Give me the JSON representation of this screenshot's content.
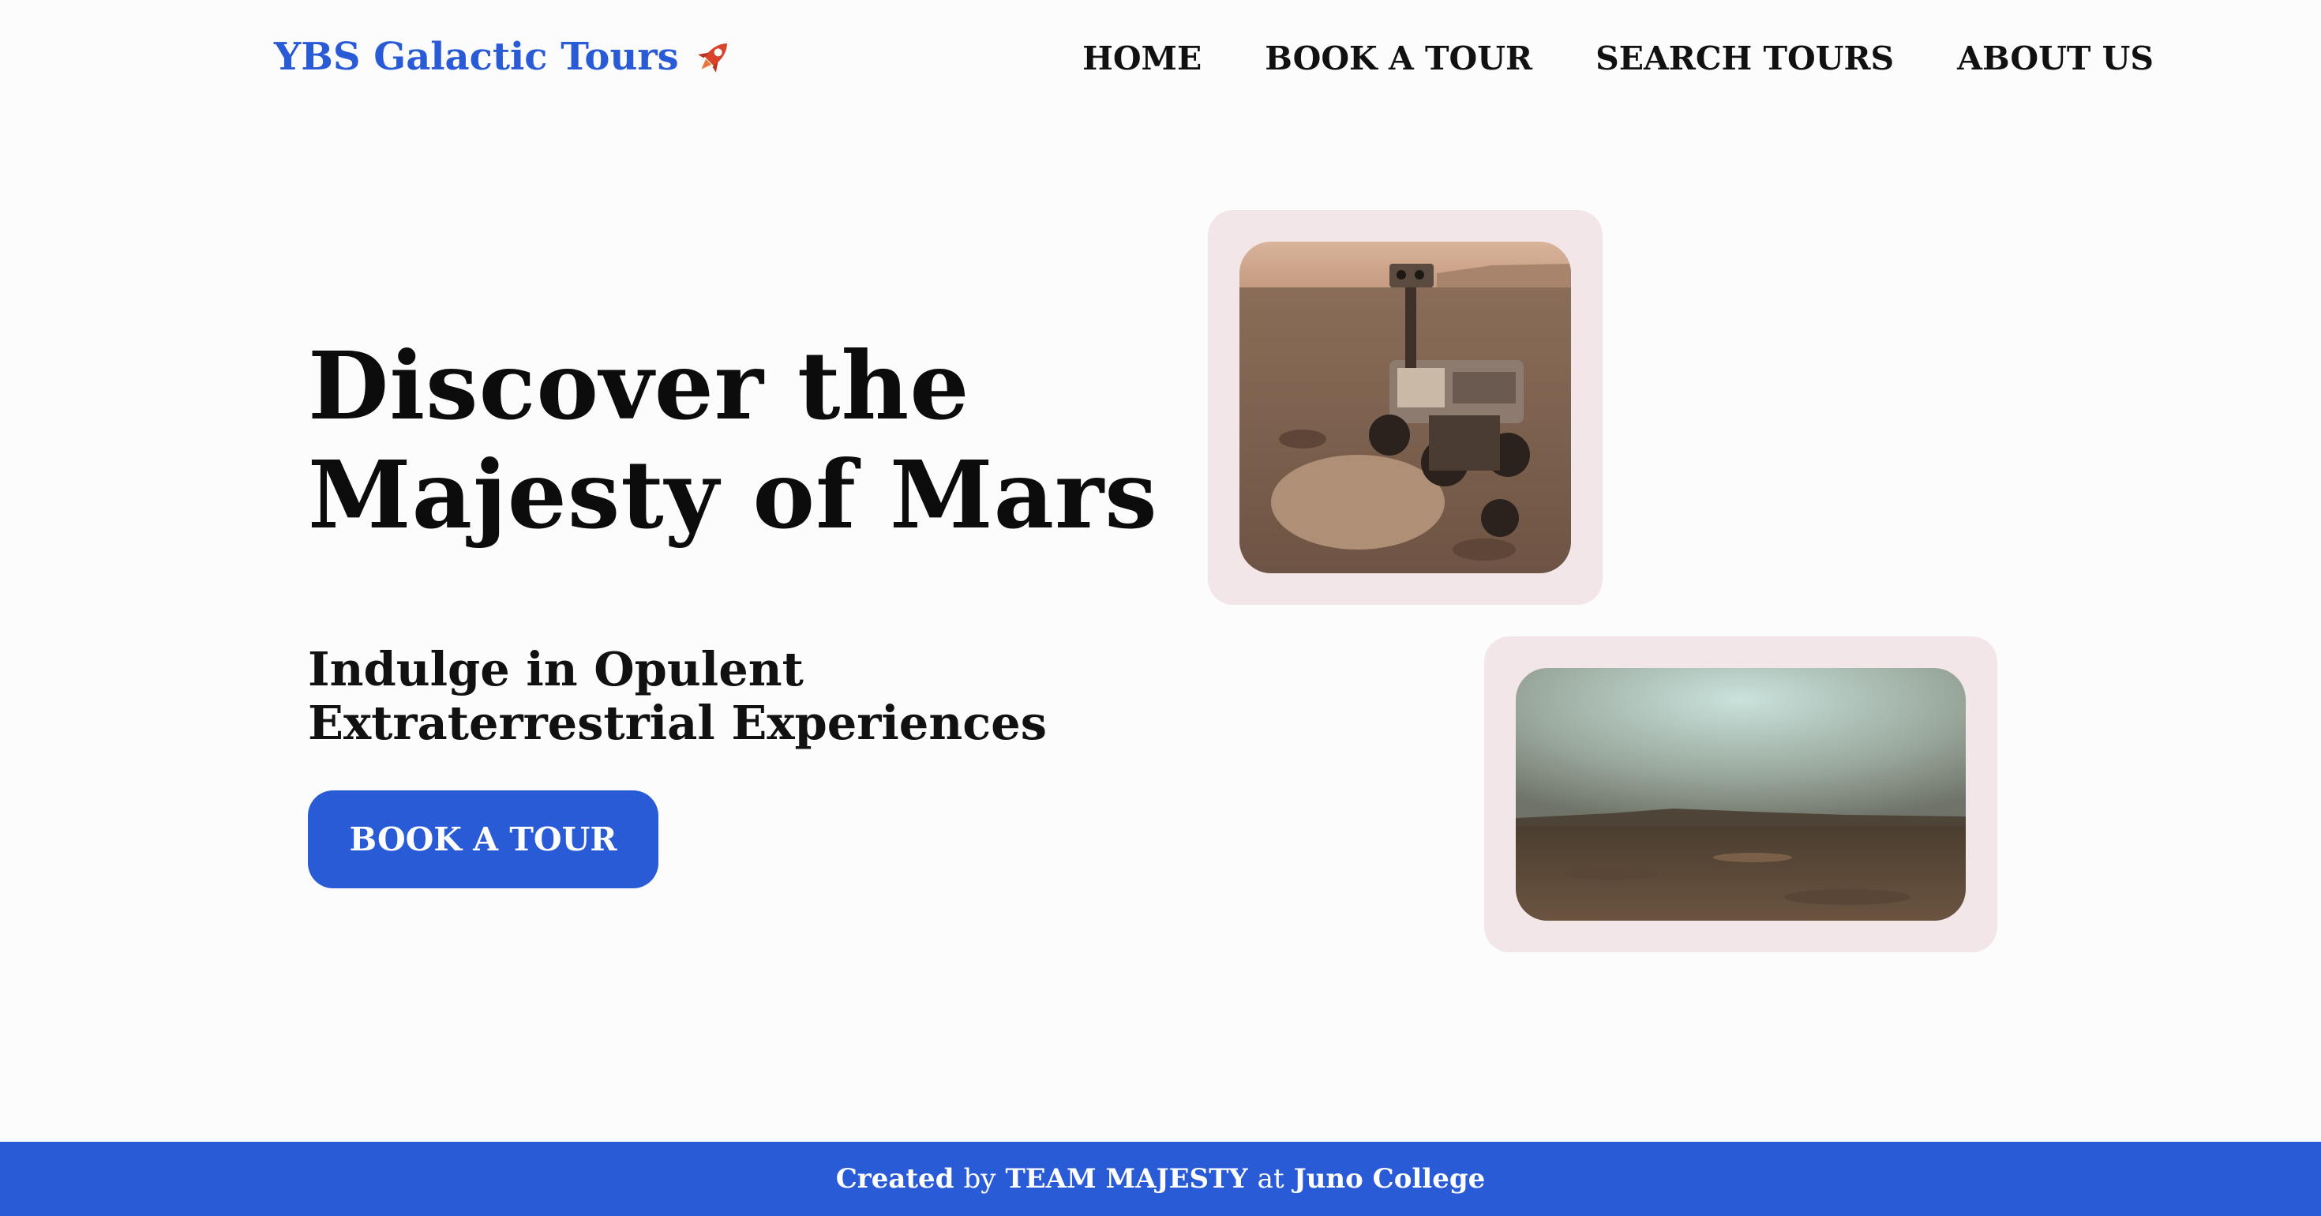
{
  "header": {
    "logo_text": "YBS Galactic Tours",
    "logo_icon": "rocket-icon",
    "nav": [
      {
        "label": "HOME"
      },
      {
        "label": "BOOK A TOUR"
      },
      {
        "label": "SEARCH TOURS"
      },
      {
        "label": "ABOUT US"
      }
    ]
  },
  "hero": {
    "title_line1": "Discover the",
    "title_line2": "Majesty of Mars",
    "subtitle": "Indulge in Opulent Extraterrestrial Experiences",
    "cta_label": "BOOK A TOUR"
  },
  "footer": {
    "created": "Created",
    "by": "by",
    "team": "TEAM MAJESTY",
    "at": "at",
    "school": "Juno College"
  },
  "colors": {
    "accent": "#2a5bd7",
    "frame": "#f3e6e8",
    "background": "#fcfcfc"
  }
}
